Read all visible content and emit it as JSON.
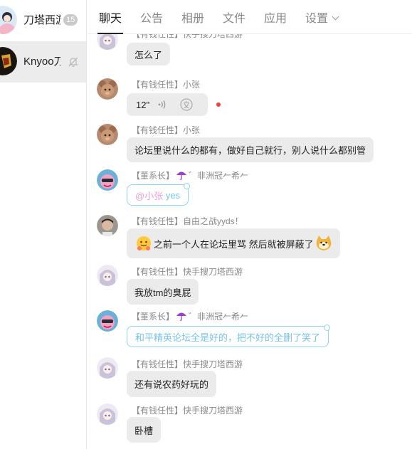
{
  "sidebar": {
    "conversations": [
      {
        "name": "刀塔西游",
        "badge": "15",
        "active": false
      },
      {
        "name": "Knyoo刀塔",
        "badge": "",
        "active": true
      }
    ]
  },
  "tabs": [
    {
      "label": "聊天",
      "active": true
    },
    {
      "label": "公告",
      "active": false
    },
    {
      "label": "相册",
      "active": false
    },
    {
      "label": "文件",
      "active": false
    },
    {
      "label": "应用",
      "active": false
    },
    {
      "label": "设置",
      "active": false
    }
  ],
  "messages": [
    {
      "sender": "【有钱任性】快手搜刀塔西游",
      "text": "怎么了"
    },
    {
      "sender": "【有钱任性】小张",
      "voice_duration": "12\""
    },
    {
      "sender": "【有钱任性】小张",
      "text": "论坛里说什么的都有，做好自己就行，别人说什么都别管"
    },
    {
      "sender_prefix": "【董系长】",
      "sender_suffix": "゛非洲冠𠂉希𠂉",
      "mention": "@小张",
      "text": " yes"
    },
    {
      "sender": "【有钱任性】自由之战yyds！",
      "text": "之前一个人在论坛里骂 然后就被屏蔽了"
    },
    {
      "sender": "【有钱任性】快手搜刀塔西游",
      "text": "我放tm的臭屁"
    },
    {
      "sender_prefix": "【董系长】",
      "sender_suffix": "゛非洲冠𠂉希𠂉",
      "text": "和平精英论坛全是好的，把不好的全删了笑了"
    },
    {
      "sender": "【有钱任性】快手搜刀塔西游",
      "text": "还有说农药好玩的"
    },
    {
      "sender": "【有钱任性】快手搜刀塔西游",
      "text": "卧槽"
    }
  ],
  "colors": {
    "leader_border": "#8fd3f0",
    "leader_text": "#7ac3e8",
    "mention": "#e8a0d6",
    "bubble": "#ebebeb",
    "unread_dot": "#f2403b"
  }
}
